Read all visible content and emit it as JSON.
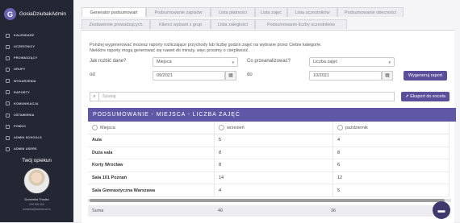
{
  "app": {
    "logo_letter": "G",
    "user_name": "GosiaDziubakAdmin"
  },
  "sidebar": {
    "items": [
      {
        "label": "KALENDARZ",
        "icon": "calendar-icon"
      },
      {
        "label": "UCZESTNICY",
        "icon": "users-icon"
      },
      {
        "label": "PROWADZĄCY",
        "icon": "teacher-icon"
      },
      {
        "label": "GRUPY",
        "icon": "group-icon"
      },
      {
        "label": "WYDARZENIA",
        "icon": "event-icon"
      },
      {
        "label": "RAPORTY",
        "icon": "reports-icon"
      },
      {
        "label": "KOMUNIKACJA",
        "icon": "chat-icon"
      },
      {
        "label": "USTAWIENIA",
        "icon": "gear-icon"
      },
      {
        "label": "POMOC",
        "icon": "help-icon"
      },
      {
        "label": "ADMIN SCHOOLS",
        "icon": "school-icon"
      },
      {
        "label": "ADMIN USERS",
        "icon": "admin-icon"
      }
    ]
  },
  "guardian": {
    "title": "Twój opiekun",
    "name": "Dominika Trocha",
    "phone": "000 000 000",
    "email": "dominika@activenow.io"
  },
  "tabs": [
    {
      "label": "Generator podsumowań",
      "active": true
    },
    {
      "label": "Podsumowanie zapisów"
    },
    {
      "label": "Lista płatności"
    },
    {
      "label": "Lista zajęć"
    },
    {
      "label": "Lista uczestników"
    },
    {
      "label": "Podsumowanie obecności"
    },
    {
      "label": "Zestawienie prowadzących"
    },
    {
      "label": "Klienci wpisani z grup"
    },
    {
      "label": "Lista zaległości"
    },
    {
      "label": "Podsumowanie liczby uczestników"
    }
  ],
  "form": {
    "description_line1": "Poniżej wygenerować możesz raporty rozliczające przychody lub liczbę godzin zajęć na wybrane przez Ciebie kategorie.",
    "description_line2": "Niektóre raporty mogą generować się nawet do minuty, więc prosimy o cierpliwość.",
    "split_label": "Jak rozbić dane?",
    "split_value": "Miejsca",
    "compare_label": "Co przeanalizować?",
    "compare_value": "Liczba zajęć",
    "from_label": "od",
    "from_value": "09/2021",
    "to_label": "do",
    "to_value": "10/2021",
    "generate_label": "Wygeneruj raport"
  },
  "search": {
    "placeholder": "Szukaj",
    "export_label": "Eksport do excela"
  },
  "report": {
    "title": "PODSUMOWANIE - MIEJSCA - LICZBA ZAJĘĆ",
    "columns": [
      "Miejsca",
      "wrzesień",
      "październik"
    ],
    "rows": [
      [
        "Aula",
        "5",
        "4"
      ],
      [
        "Duża sala",
        "8",
        "8"
      ],
      [
        "Korty Wrocław",
        "8",
        "6"
      ],
      [
        "Sala 101 Poznań",
        "14",
        "12"
      ],
      [
        "Sala Gimnastyczna Warszawa",
        "4",
        "5"
      ]
    ],
    "sum_label": "Suma",
    "sum_values": [
      "40",
      "36"
    ]
  },
  "colors": {
    "accent": "#5f58a7",
    "sidebar": "#232733"
  }
}
